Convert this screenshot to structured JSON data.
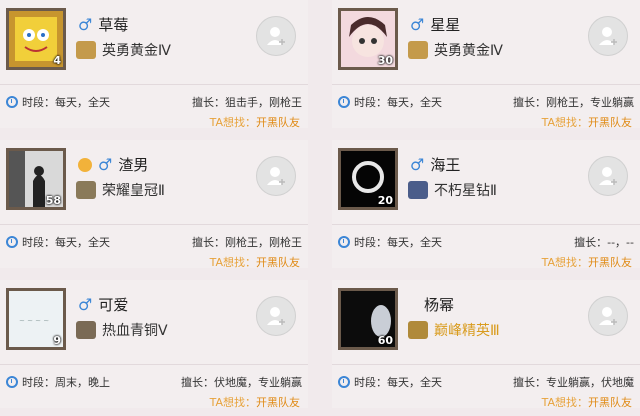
{
  "cards": [
    {
      "name": "草莓",
      "gender": "♂",
      "rank": "英勇黄金Ⅳ",
      "level": "4",
      "time": "时段：每天，全天",
      "skill": "擅长：狙击手，刚枪王",
      "wants_label": "TA想找：",
      "wants_value": "开黑队友"
    },
    {
      "name": "星星",
      "gender": "♂",
      "rank": "英勇黄金Ⅳ",
      "level": "30",
      "time": "时段：每天，全天",
      "skill": "擅长：刚枪王，专业躺赢",
      "wants_label": "TA想找：",
      "wants_value": "开黑队友"
    },
    {
      "name": "渣男",
      "gender": "♂",
      "rank": "荣耀皇冠Ⅱ",
      "level": "58",
      "time": "时段：每天，全天",
      "skill": "擅长：刚枪王，刚枪王",
      "wants_label": "TA想找：",
      "wants_value": "开黑队友"
    },
    {
      "name": "海王",
      "gender": "♂",
      "rank": "不朽星钻Ⅱ",
      "level": "20",
      "time": "时段：每天，全天",
      "skill": "擅长：--，--",
      "wants_label": "TA想找：",
      "wants_value": "开黑队友"
    },
    {
      "name": "可爱",
      "gender": "♂",
      "rank": "热血青铜Ⅴ",
      "level": "9",
      "time": "时段：周末，晚上",
      "skill": "擅长：伏地魔，专业躺赢",
      "wants_label": "TA想找：",
      "wants_value": "开黑队友"
    },
    {
      "name": "杨幂",
      "gender": "",
      "rank": "巅峰精英Ⅲ",
      "level": "60",
      "time": "时段：每天，全天",
      "skill": "擅长：专业躺赢，伏地魔",
      "wants_label": "TA想找：",
      "wants_value": "开黑队友"
    }
  ],
  "colors": {
    "accent": "#3c86d6",
    "wants": "#e7a23a"
  }
}
